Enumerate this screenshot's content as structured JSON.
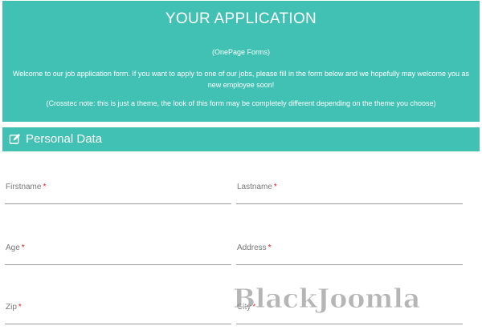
{
  "header": {
    "title": "YOUR APPLICATION",
    "subtitle": "(OnePage Forms)",
    "welcome": "Welcome to our job application form. If you want to apply to one of our jobs, please fill in the form below and we hopefully may welcome you as new employee soon!",
    "note": "(Crosstec note: this is just a theme, the look of this form may be completely different depending on the theme you choose)"
  },
  "section": {
    "title": "Personal Data",
    "icon": "edit-icon"
  },
  "fields": {
    "firstname": {
      "label": "Firstname",
      "required": "*"
    },
    "lastname": {
      "label": "Lastname",
      "required": "*"
    },
    "age": {
      "label": "Age",
      "required": "*"
    },
    "address": {
      "label": "Address",
      "required": "*"
    },
    "zip": {
      "label": "Zip",
      "required": "*"
    },
    "city": {
      "label": "City",
      "required": "*"
    }
  },
  "watermark": {
    "text": "BlackJoomla"
  },
  "colors": {
    "accent": "#40c1b3",
    "required": "#e02020",
    "label": "#777777"
  }
}
